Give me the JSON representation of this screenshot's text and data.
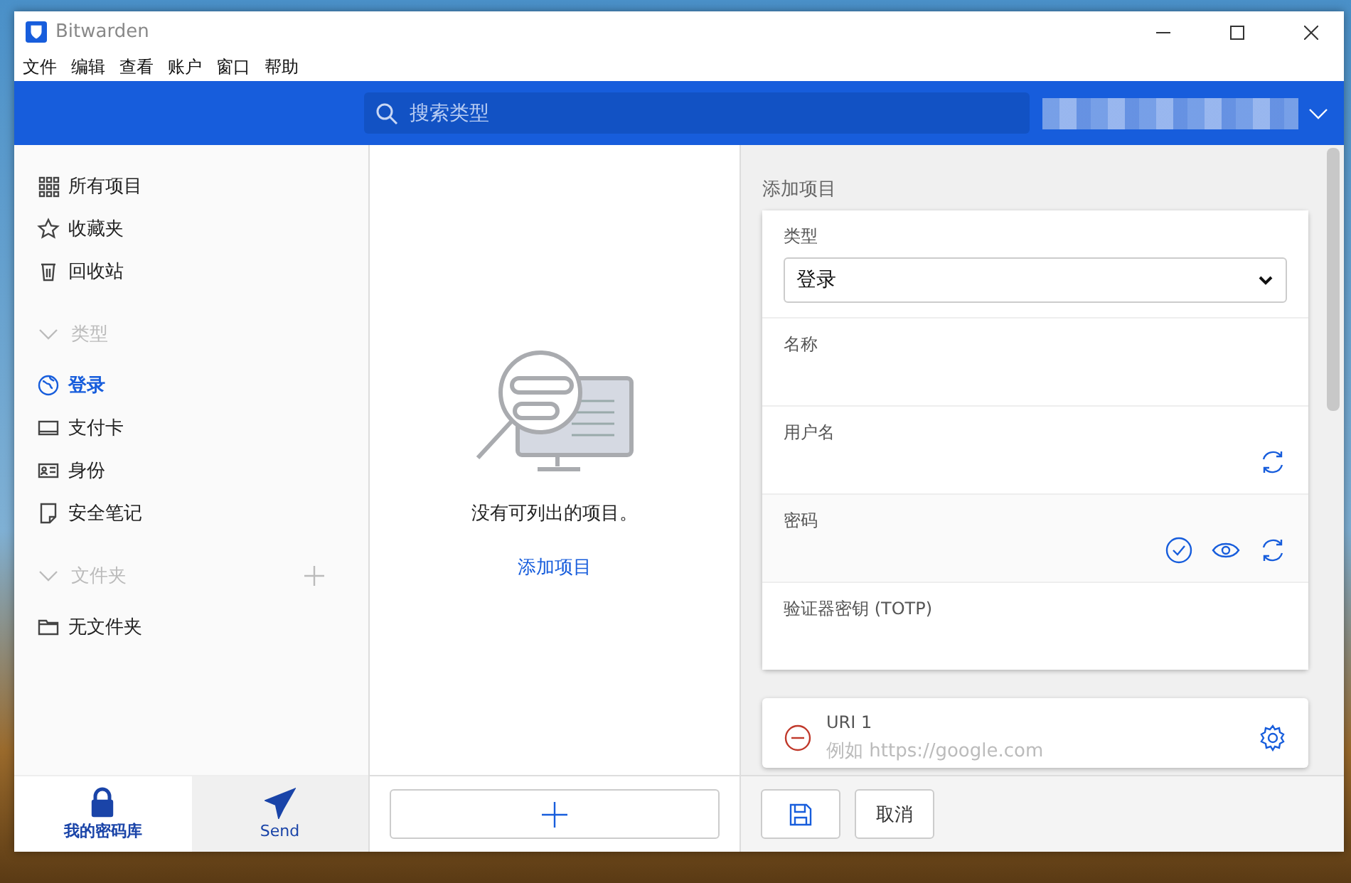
{
  "window": {
    "title": "Bitwarden"
  },
  "menu": [
    "文件",
    "编辑",
    "查看",
    "账户",
    "窗口",
    "帮助"
  ],
  "search": {
    "placeholder": "搜索类型"
  },
  "sidebar": {
    "items": [
      {
        "label": "所有项目",
        "selected": false
      },
      {
        "label": "收藏夹",
        "selected": false
      },
      {
        "label": "回收站",
        "selected": false
      }
    ],
    "sections": [
      {
        "title": "类型",
        "expanded": true,
        "can_add": false,
        "items": [
          {
            "label": "登录",
            "selected": true
          },
          {
            "label": "支付卡",
            "selected": false
          },
          {
            "label": "身份",
            "selected": false
          },
          {
            "label": "安全笔记",
            "selected": false
          }
        ]
      },
      {
        "title": "文件夹",
        "expanded": true,
        "can_add": true,
        "items": [
          {
            "label": "无文件夹",
            "selected": false
          }
        ]
      }
    ]
  },
  "list": {
    "empty_message": "没有可列出的项目。",
    "add_link": "添加项目"
  },
  "editor": {
    "heading": "添加项目",
    "fields": [
      {
        "kind": "select",
        "label": "类型",
        "value": "登录"
      },
      {
        "kind": "text",
        "label": "名称"
      },
      {
        "kind": "username",
        "label": "用户名"
      },
      {
        "kind": "password",
        "label": "密码"
      },
      {
        "kind": "text",
        "label": "验证器密钥 (TOTP)"
      }
    ],
    "uri": {
      "label": "URI 1",
      "placeholder": "例如 https://google.com"
    }
  },
  "nav": [
    {
      "label": "我的密码库",
      "selected": true
    },
    {
      "label": "Send",
      "selected": false
    }
  ],
  "actions": {
    "cancel": "取消"
  }
}
